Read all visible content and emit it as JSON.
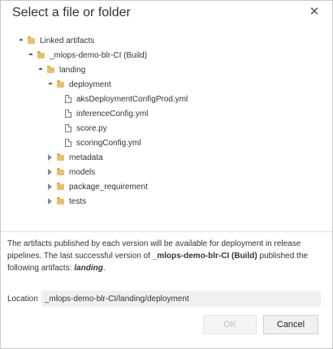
{
  "dialog": {
    "title": "Select a file or folder",
    "close_glyph": "✕"
  },
  "tree": {
    "root": {
      "label": "Linked artifacts",
      "expanded": true,
      "icon": "folder-icon"
    },
    "build": {
      "label": "_mlops-demo-blr-CI (Build)",
      "expanded": true,
      "icon": "folder-icon"
    },
    "landing": {
      "label": "landing",
      "expanded": true,
      "icon": "folder-icon"
    },
    "deployment": {
      "label": "deployment",
      "expanded": true,
      "icon": "folder-icon"
    },
    "files": [
      {
        "label": "aksDeploymentConfigProd.yml",
        "icon": "file-icon"
      },
      {
        "label": "inferenceConfig.yml",
        "icon": "file-icon"
      },
      {
        "label": "score.py",
        "icon": "file-icon"
      },
      {
        "label": "scoringConfig.yml",
        "icon": "file-icon"
      }
    ],
    "folders": [
      {
        "label": "metadata",
        "expanded": false,
        "icon": "folder-icon"
      },
      {
        "label": "models",
        "expanded": false,
        "icon": "folder-icon"
      },
      {
        "label": "package_requirement",
        "expanded": false,
        "icon": "folder-icon"
      },
      {
        "label": "tests",
        "expanded": false,
        "icon": "folder-icon"
      }
    ]
  },
  "info": {
    "text_1": "The artifacts published by each version will be available for deployment in release pipelines. The last successful version of ",
    "build_name": "_mlops-demo-blr-CI (Build)",
    "text_2": " published the following artifacts: ",
    "artifacts": "landing",
    "text_3": "."
  },
  "location": {
    "label": "Location",
    "value": "_mlops-demo-blr-CI/landing/deployment"
  },
  "buttons": {
    "ok_label": "OK",
    "cancel_label": "Cancel"
  },
  "colors": {
    "folder": "#e8c06a",
    "input_bg": "#f0f0f0",
    "disabled_text": "#c0c0c0"
  }
}
